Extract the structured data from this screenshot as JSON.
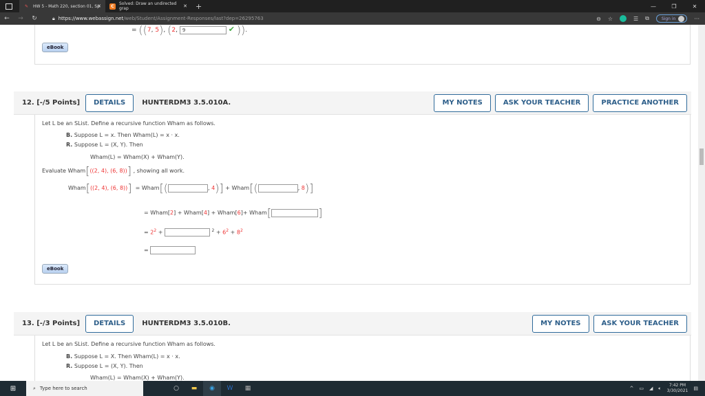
{
  "browser": {
    "tabs": [
      {
        "title": "HW 5 - Math 220, section 01, Sp",
        "icon": "webassign-icon",
        "active": true
      },
      {
        "title": "Solved: Draw an undirected grap",
        "icon": "chegg-icon",
        "active": false
      }
    ],
    "url_host": "https://www.webassign.net",
    "url_path": "/web/Student/Assignment-Responses/last?dep=26295763",
    "signin_label": "Sign in"
  },
  "prev": {
    "equals": "=",
    "pair1_a": "7",
    "pair1_b": "5",
    "pair2_a": "2",
    "input_value": "9",
    "ebook": "eBook"
  },
  "q12": {
    "number": "12.",
    "points": "[-/5 Points]",
    "details": "DETAILS",
    "id": "HUNTERDM3 3.5.010A.",
    "buttons": [
      "MY NOTES",
      "ASK YOUR TEACHER",
      "PRACTICE ANOTHER"
    ],
    "intro": "Let L be an SList. Define a recursive function Wham as follows.",
    "b_label": "B.",
    "b_text": "Suppose L = x. Then Wham(L) = x · x.",
    "r_label": "R.",
    "r_text": "Suppose L = (X, Y). Then",
    "rule": "Wham(L) = Wham(X) + Wham(Y).",
    "evaluate": "Evaluate",
    "wham": "Wham",
    "list": "((2, 4), (6, 8))",
    "show": ", showing all work.",
    "step1_right1": "4",
    "step1_right2": "8",
    "step2_vals": [
      "2",
      "4",
      "6"
    ],
    "step3": {
      "a": "2",
      "c": "6",
      "d": "8"
    },
    "ebook": "eBook"
  },
  "q13": {
    "number": "13.",
    "points": "[-/3 Points]",
    "details": "DETAILS",
    "id": "HUNTERDM3 3.5.010B.",
    "buttons": [
      "MY NOTES",
      "ASK YOUR TEACHER"
    ],
    "intro": "Let L be an SList. Define a recursive function Wham as follows.",
    "b_label": "B.",
    "b_text": "Suppose L = X. Then Wham(L) = x · x.",
    "r_label": "R.",
    "r_text": "Suppose L = (X, Y). Then",
    "rule": "Wham(L) = Wham(X) + Wham(Y)."
  },
  "taskbar": {
    "search_placeholder": "Type here to search",
    "time": "7:42 PM",
    "date": "3/30/2021"
  }
}
